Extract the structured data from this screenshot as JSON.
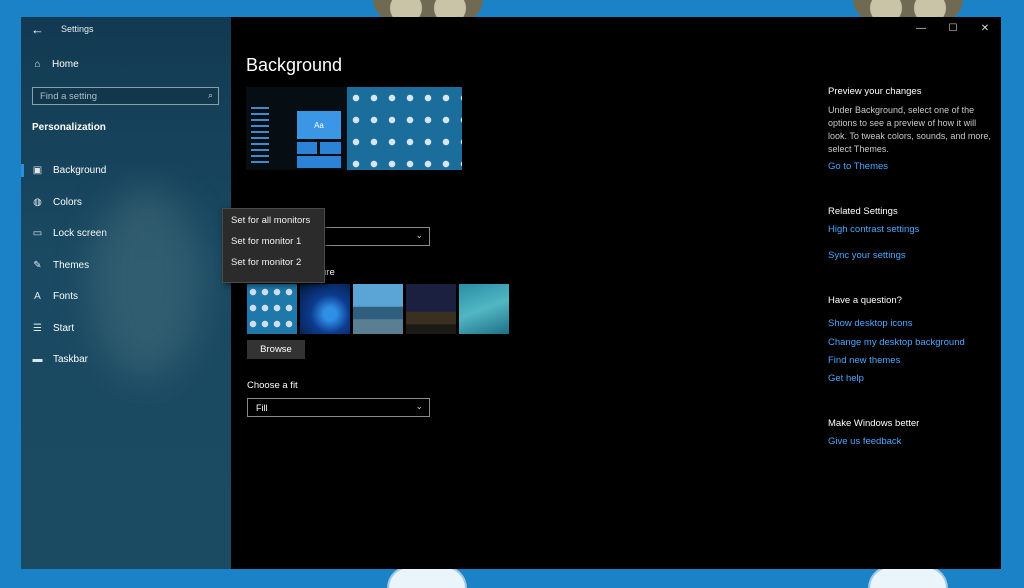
{
  "window": {
    "app_title": "Settings",
    "controls": [
      "—",
      "☐",
      "✕"
    ]
  },
  "sidebar": {
    "home": "Home",
    "search_placeholder": "Find a setting",
    "section": "Personalization",
    "items": [
      {
        "label": "Background",
        "icon": "picture-icon",
        "selected": true
      },
      {
        "label": "Colors",
        "icon": "palette-icon",
        "selected": false
      },
      {
        "label": "Lock screen",
        "icon": "lock-screen-icon",
        "selected": false
      },
      {
        "label": "Themes",
        "icon": "themes-icon",
        "selected": false
      },
      {
        "label": "Fonts",
        "icon": "fonts-icon",
        "selected": false
      },
      {
        "label": "Start",
        "icon": "start-icon",
        "selected": false
      },
      {
        "label": "Taskbar",
        "icon": "taskbar-icon",
        "selected": false
      }
    ]
  },
  "main": {
    "title": "Background",
    "preview_tile_text": "Aa",
    "choose_picture_label": "ure",
    "browse_label": "Browse",
    "fit_label": "Choose a fit",
    "fit_value": "Fill",
    "context_menu": [
      "Set for all monitors",
      "Set for monitor 1",
      "Set for monitor 2"
    ]
  },
  "right_panel": {
    "preview_heading": "Preview your changes",
    "preview_text": "Under Background, select one of the options to see a preview of how it will look. To tweak colors, sounds, and more, select Themes.",
    "go_to_themes": "Go to Themes",
    "related_heading": "Related Settings",
    "high_contrast": "High contrast settings",
    "sync_settings": "Sync your settings",
    "question_heading": "Have a question?",
    "help_links": [
      "Show desktop icons",
      "Change my desktop background",
      "Find new themes",
      "Get help"
    ],
    "better_heading": "Make Windows better",
    "feedback": "Give us feedback"
  },
  "colors": {
    "accent": "#2b8fe0",
    "link": "#4aa8ff",
    "desktop": "#1c82c7"
  }
}
